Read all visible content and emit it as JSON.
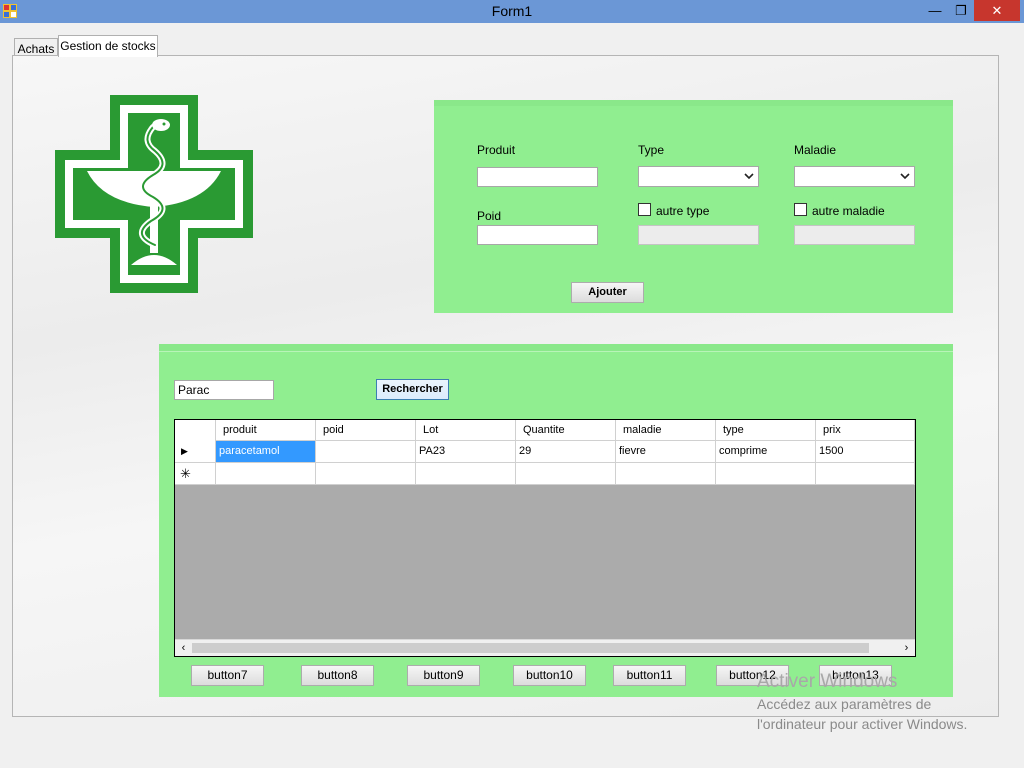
{
  "window": {
    "title": "Form1",
    "minimize_glyph": "—",
    "restore_glyph": "❐",
    "close_glyph": "✕"
  },
  "tabs": [
    {
      "label": "Achats"
    },
    {
      "label": "Gestion de stocks",
      "active": true
    }
  ],
  "form": {
    "produit_label": "Produit",
    "produit_value": "",
    "type_label": "Type",
    "type_selected": "",
    "maladie_label": "Maladie",
    "maladie_selected": "",
    "poid_label": "Poid",
    "poid_value": "",
    "autre_type_label": "autre type",
    "autre_type_checked": false,
    "autre_maladie_label": "autre maladie",
    "autre_maladie_checked": false,
    "ajouter_label": "Ajouter"
  },
  "search": {
    "value": "Parac",
    "button_label": "Rechercher"
  },
  "grid": {
    "columns": [
      "produit",
      "poid",
      "Lot",
      "Quantite",
      "maladie",
      "type",
      "prix"
    ],
    "rows": [
      [
        "paracetamol",
        "",
        "PA23",
        "29",
        "fievre",
        "comprime",
        "1500"
      ]
    ],
    "current_row_glyph": "▶",
    "new_row_glyph": "✳",
    "scroll_left": "‹",
    "scroll_right": "›"
  },
  "bottom_buttons": [
    "button7",
    "button8",
    "button9",
    "button10",
    "button11",
    "button12",
    "button13"
  ],
  "watermark": {
    "line1": "Activer Windows",
    "line2": "Accédez aux paramètres de",
    "line3": "l'ordinateur pour activer Windows."
  },
  "colors": {
    "panel_green": "#90ee90",
    "logo_green": "#2a9a33",
    "selection_blue": "#3399ff",
    "titlebar": "#6b97d6"
  }
}
